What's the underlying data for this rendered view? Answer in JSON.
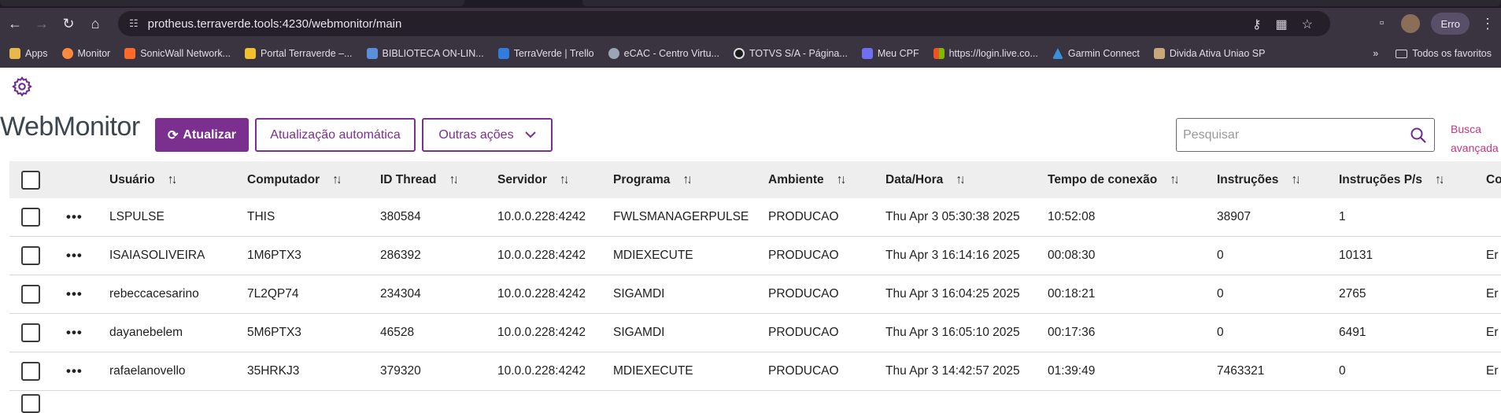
{
  "browser": {
    "url": "protheus.terraverde.tools:4230/webmonitor/main",
    "profile_label": "Erro",
    "bookmarks": [
      {
        "label": "Apps",
        "color": "#e8b84a"
      },
      {
        "label": "Monitor",
        "color": "#ff8a3d"
      },
      {
        "label": "SonicWall Network...",
        "color": "#ff6a2a"
      },
      {
        "label": "Portal Terraverde –...",
        "color": "#f2c12e"
      },
      {
        "label": "BIBLIOTECA ON-LIN...",
        "color": "#5b8fd9"
      },
      {
        "label": "TerraVerde | Trello",
        "color": "#2f7de1"
      },
      {
        "label": "eCAC - Centro Virtu...",
        "color": "#9aa6b5"
      },
      {
        "label": "TOTVS S/A - Página...",
        "color": "#1b1b1b"
      },
      {
        "label": "Meu CPF",
        "color": "#6f6ff2"
      },
      {
        "label": "https://login.live.co...",
        "color": "#f25022"
      },
      {
        "label": "Garmin Connect",
        "color": "#3b8fd9"
      },
      {
        "label": "Divida Ativa Uniao SP",
        "color": "#c8a77a"
      }
    ],
    "bookmarks_overflow": "»",
    "all_bookmarks_label": "Todos os favoritos"
  },
  "app": {
    "brand": "WebMonitor",
    "refresh_label": "Atualizar",
    "auto_refresh_label": "Atualização automática",
    "more_actions_label": "Outras ações",
    "search_placeholder": "Pesquisar",
    "advanced_search_label": "Busca avançada",
    "accent_color": "#7b2f8f",
    "link_color": "#c4367d"
  },
  "table": {
    "columns": [
      "Usuário",
      "Computador",
      "ID Thread",
      "Servidor",
      "Programa",
      "Ambiente",
      "Data/Hora",
      "Tempo de conexão",
      "Instruções",
      "Instruções P/s",
      "Co"
    ],
    "rows": [
      [
        "LSPULSE",
        "THIS",
        "380584",
        "10.0.0.228:4242",
        "FWLSMANAGERPULSE",
        "PRODUCAO",
        "Thu Apr 3 05:30:38 2025",
        "10:52:08",
        "38907",
        "1",
        ""
      ],
      [
        "ISAIASOLIVEIRA",
        "1M6PTX3",
        "286392",
        "10.0.0.228:4242",
        "MDIEXECUTE",
        "PRODUCAO",
        "Thu Apr 3 16:14:16 2025",
        "00:08:30",
        "0",
        "10131",
        "Er"
      ],
      [
        "rebeccacesarino",
        "7L2QP74",
        "234304",
        "10.0.0.228:4242",
        "SIGAMDI",
        "PRODUCAO",
        "Thu Apr 3 16:04:25 2025",
        "00:18:21",
        "0",
        "2765",
        "Er"
      ],
      [
        "dayanebelem",
        "5M6PTX3",
        "46528",
        "10.0.0.228:4242",
        "SIGAMDI",
        "PRODUCAO",
        "Thu Apr 3 16:05:10 2025",
        "00:17:36",
        "0",
        "6491",
        "Er"
      ],
      [
        "rafaelanovello",
        "35HRKJ3",
        "379320",
        "10.0.0.228:4242",
        "MDIEXECUTE",
        "PRODUCAO",
        "Thu Apr 3 14:42:57 2025",
        "01:39:49",
        "7463321",
        "0",
        "Er"
      ]
    ]
  }
}
